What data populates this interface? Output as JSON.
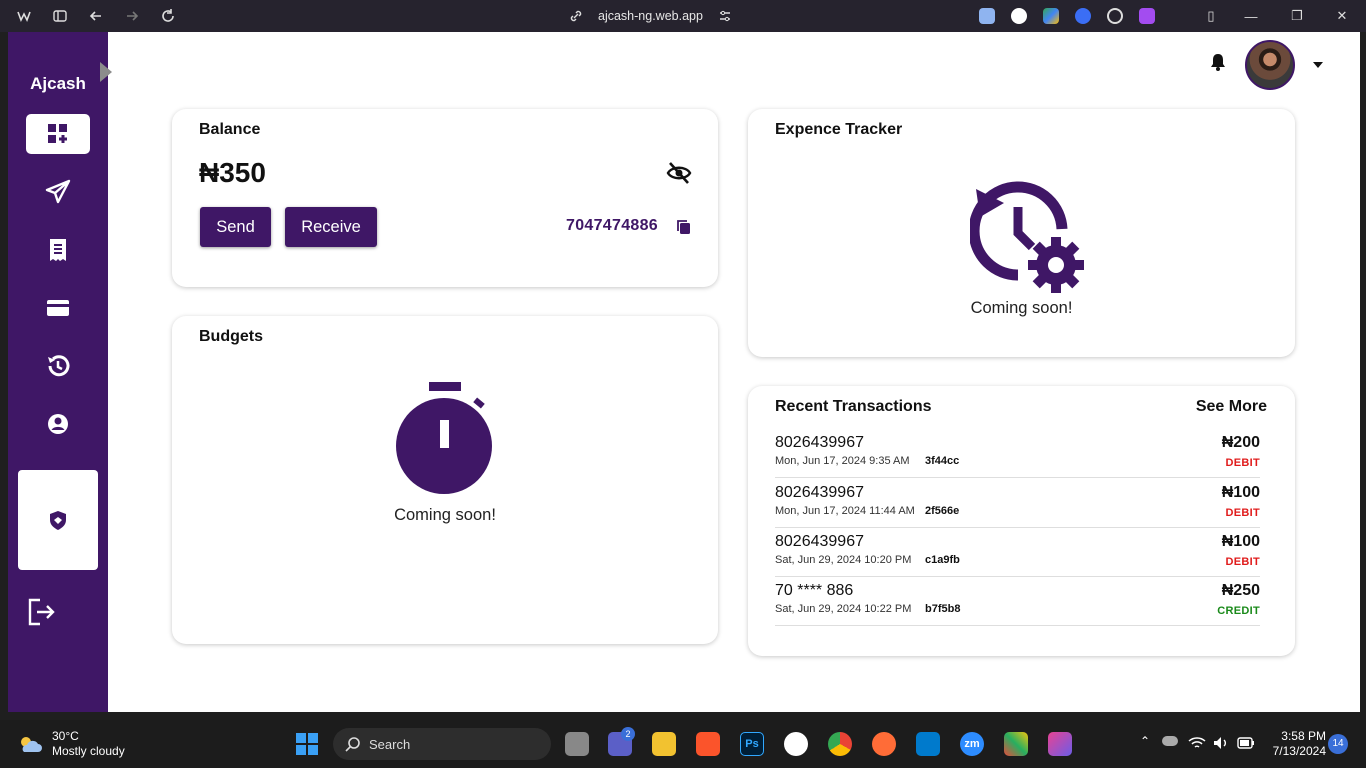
{
  "browser": {
    "url": "ajcash-ng.web.app"
  },
  "app": {
    "brand": "Ajcash",
    "nav_items": [
      "dashboard-icon",
      "send-icon",
      "receipt-icon",
      "card-icon",
      "history-icon",
      "account-icon"
    ]
  },
  "balance": {
    "title": "Balance",
    "amount": "₦350",
    "send_label": "Send",
    "receive_label": "Receive",
    "account_number": "7047474886"
  },
  "budgets": {
    "title": "Budgets",
    "coming_soon": "Coming soon!"
  },
  "expense": {
    "title": "Expence Tracker",
    "coming_soon": "Coming soon!"
  },
  "transactions": {
    "title": "Recent Transactions",
    "see_more": "See More",
    "items": [
      {
        "number": "8026439967",
        "date": "Mon, Jun 17, 2024 9:35 AM",
        "ref": "3f44cc",
        "amount": "₦200",
        "type": "DEBIT"
      },
      {
        "number": "8026439967",
        "date": "Mon, Jun 17, 2024 11:44 AM",
        "ref": "2f566e",
        "amount": "₦100",
        "type": "DEBIT"
      },
      {
        "number": "8026439967",
        "date": "Sat, Jun 29, 2024 10:20 PM",
        "ref": "c1a9fb",
        "amount": "₦100",
        "type": "DEBIT"
      },
      {
        "number": "70 **** 886",
        "date": "Sat, Jun 29, 2024 10:22 PM",
        "ref": "b7f5b8",
        "amount": "₦250",
        "type": "CREDIT"
      }
    ]
  },
  "colors": {
    "brand": "#3f1766",
    "debit": "#e01b1b",
    "credit": "#1a8a1a"
  },
  "taskbar": {
    "temperature": "30°C",
    "weather": "Mostly cloudy",
    "search_label": "Search",
    "teams_badge": "2",
    "time": "3:58 PM",
    "date": "7/13/2024",
    "notification_count": "14"
  }
}
